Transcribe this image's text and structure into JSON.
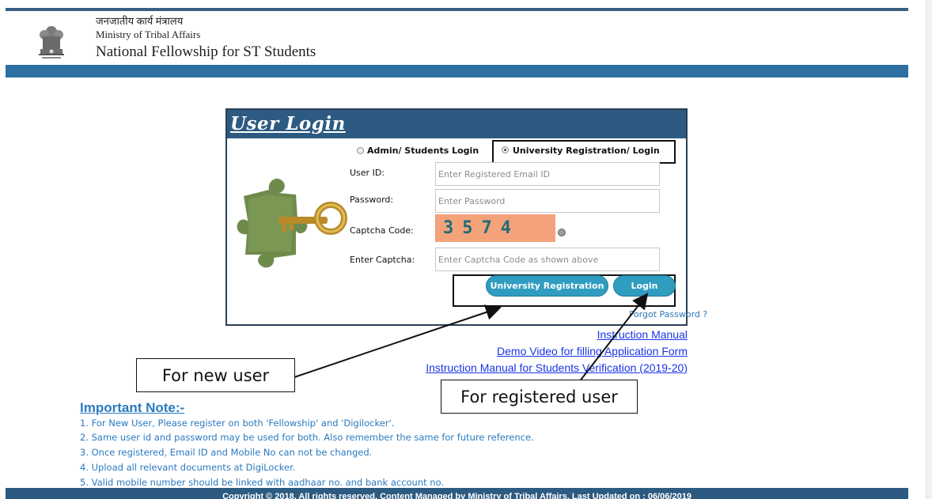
{
  "header": {
    "hindi_title": "जनजातीय कार्य मंत्रालय",
    "ministry": "Ministry of Tribal Affairs",
    "title": "National Fellowship for ST Students",
    "emblem_icon": "national-emblem-icon"
  },
  "login": {
    "title": "User Login",
    "radio_admin": "Admin/ Students Login",
    "radio_university": "University Registration/ Login",
    "selected": "University Registration/ Login",
    "user_id_label": "User ID:",
    "user_id_placeholder": "Enter Registered Email ID",
    "password_label": "Password:",
    "password_placeholder": "Enter Password",
    "captcha_label": "Captcha Code:",
    "captcha_code": "3574",
    "enter_captcha_label": "Enter Captcha:",
    "enter_captcha_placeholder": "Enter Captcha Code as shown above",
    "university_registration_button": "University Registration",
    "login_button": "Login",
    "forgot_password": "Forgot Password ?",
    "refresh_icon": "refresh-captcha-icon",
    "puzzle_key_icon": "puzzle-key-image"
  },
  "links": {
    "instruction_manual": "Instruction Manual",
    "demo_video": "Demo Video for filling Application Form",
    "students_verification": "Instruction Manual for Students Verification (2019-20)"
  },
  "callouts": {
    "new_user": "For new user",
    "registered_user": "For registered user"
  },
  "notes": {
    "title": "Important Note:-",
    "items": [
      "1. For New User, Please register on both 'Fellowship' and 'Digilocker'.",
      "2. Same user id and password may be used for both. Also remember the same for future reference.",
      "3. Once registered, Email ID and Mobile No can not be changed.",
      "4. Upload all relevant documents at DigiLocker.",
      "5. Valid mobile number should be linked with aadhaar no. and bank account no."
    ]
  },
  "footer": {
    "text": "Copyright © 2018. All rights reserved. Content Managed by Ministry of Tribal Affairs. Last Updated on : 06/06/2019"
  },
  "colors": {
    "header_band": "#2c6fa0",
    "login_header": "#2c5a80",
    "button": "#2f9cc0",
    "captcha_bg": "#f4a27a",
    "note_text": "#2a7abf",
    "link": "#1a33e6"
  }
}
